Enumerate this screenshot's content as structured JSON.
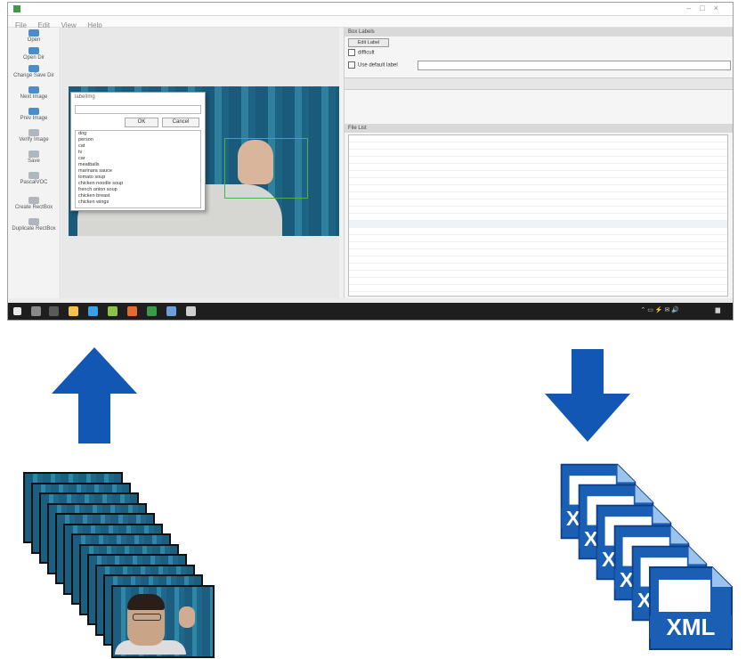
{
  "app": {
    "window_title": "",
    "menu": [
      "File",
      "Edit",
      "View",
      "Help"
    ]
  },
  "toolbar": {
    "items": [
      {
        "label": "Open",
        "icon": "folder-icon"
      },
      {
        "label": "Open Dir",
        "icon": "folder-icon"
      },
      {
        "label": "Change Save Dir",
        "icon": "folder-icon"
      },
      {
        "label": "Next Image",
        "icon": "arrow-right-icon"
      },
      {
        "label": "Prev Image",
        "icon": "arrow-left-icon"
      },
      {
        "label": "Verify Image",
        "icon": "check-icon"
      },
      {
        "label": "Save",
        "icon": "save-icon"
      },
      {
        "label": "PascalVOC",
        "icon": "format-icon"
      },
      {
        "label": "Create RectBox",
        "icon": "rect-icon"
      },
      {
        "label": "Duplicate RectBox",
        "icon": "duplicate-icon"
      }
    ]
  },
  "label_dialog": {
    "title": "labelImg",
    "ok": "OK",
    "cancel": "Cancel",
    "options": [
      "dog",
      "person",
      "cat",
      "tv",
      "car",
      "meatballs",
      "marinara sauce",
      "tomato soup",
      "chicken noodle soup",
      "french onion soup",
      "chicken breast",
      "chicken wings"
    ]
  },
  "right_panel": {
    "box_labels_header": "Box Labels",
    "edit_label": "Edit Label",
    "difficult": "difficult",
    "use_default_label": "Use default label",
    "file_list_header": "File List"
  },
  "file_list": {
    "row_count": 26
  },
  "colors": {
    "arrow_blue": "#1257b3",
    "xml_blue": "#1a5fb4",
    "bbox_green": "#4caf50"
  },
  "diagram": {
    "left_arrow_direction": "up",
    "right_arrow_direction": "down",
    "image_stack_count": 12,
    "xml_stack_count": 6,
    "xml_text": "XML"
  }
}
